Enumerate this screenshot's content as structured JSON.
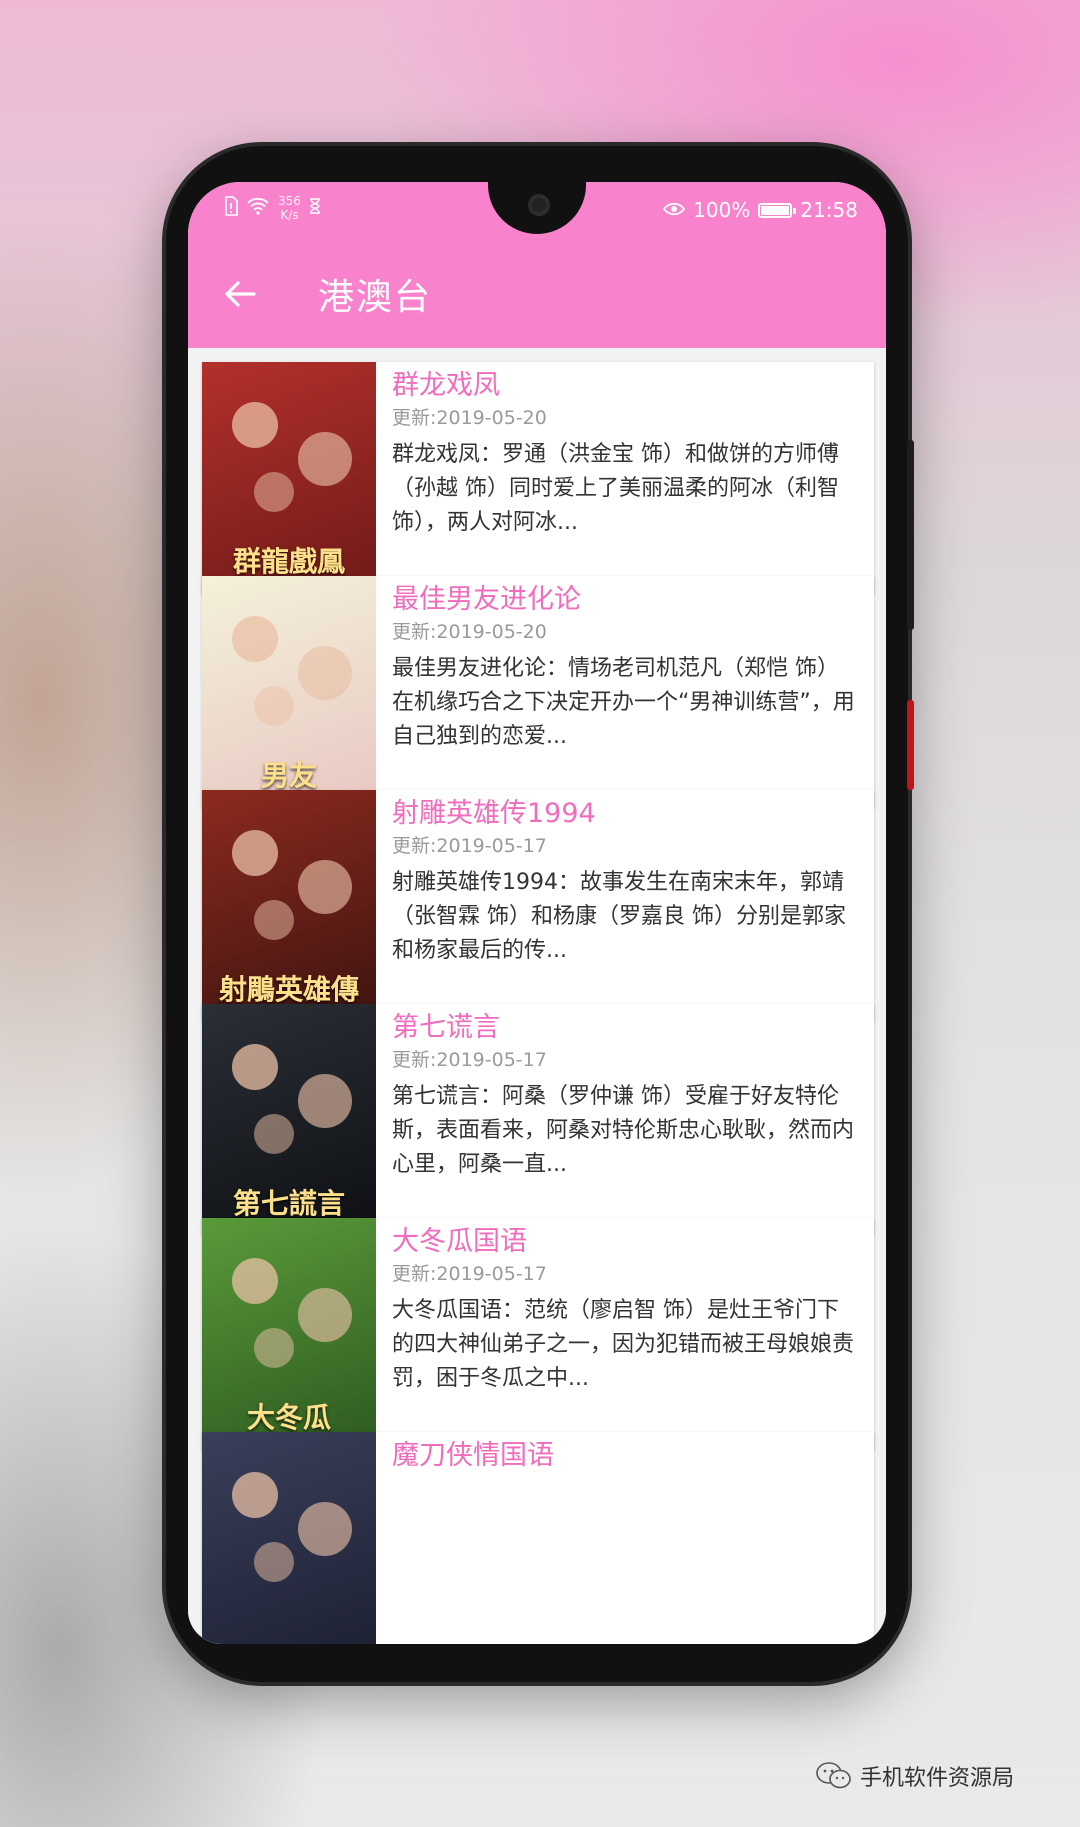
{
  "status_bar": {
    "net_speed_value": "356",
    "net_speed_unit": "K/s",
    "battery": "100%",
    "battery_level": 1.0,
    "time": "21:58"
  },
  "app_bar": {
    "title": "港澳台"
  },
  "items": [
    {
      "title": "群龙戏凤",
      "updated": "更新:2019-05-20",
      "description": "群龙戏凤：罗通（洪金宝 饰）和做饼的方师傅（孙越 饰）同时爱上了美丽温柔的阿冰（利智 饰），两人对阿冰...",
      "poster_text": "群龍戲鳳",
      "poster_colors": [
        "#b3302b",
        "#6e1a18"
      ]
    },
    {
      "title": "最佳男友进化论",
      "updated": "更新:2019-05-20",
      "description": "最佳男友进化论：情场老司机范凡（郑恺 饰）在机缘巧合之下决定开办一个“男神训练营”，用自己独到的恋爱...",
      "poster_text": "男友",
      "poster_colors": [
        "#f4f1da",
        "#e8c7c2"
      ]
    },
    {
      "title": "射雕英雄传1994",
      "updated": "更新:2019-05-17",
      "description": "射雕英雄传1994：故事发生在南宋末年，郭靖（张智霖 饰）和杨康（罗嘉良 饰）分别是郭家和杨家最后的传...",
      "poster_text": "射鵰英雄傳",
      "poster_colors": [
        "#8c2a1f",
        "#3e1410"
      ]
    },
    {
      "title": "第七谎言",
      "updated": "更新:2019-05-17",
      "description": "第七谎言：阿桑（罗仲谦 饰）受雇于好友特伦斯，表面看来，阿桑对特伦斯忠心耿耿，然而内心里，阿桑一直...",
      "poster_text": "第七謊言",
      "poster_colors": [
        "#2b2f36",
        "#0d0f13"
      ]
    },
    {
      "title": "大冬瓜国语",
      "updated": "更新:2019-05-17",
      "description": "大冬瓜国语：范统（廖启智 饰）是灶王爷门下的四大神仙弟子之一，因为犯错而被王母娘娘责罚，困于冬瓜之中...",
      "poster_text": "大冬瓜",
      "poster_colors": [
        "#5a9a3a",
        "#2d5a20"
      ]
    },
    {
      "title": "魔刀侠情国语",
      "updated": "",
      "description": "",
      "poster_text": "",
      "poster_colors": [
        "#3a3f5a",
        "#1d2033"
      ]
    }
  ],
  "watermark": {
    "text": "手机软件资源局"
  }
}
